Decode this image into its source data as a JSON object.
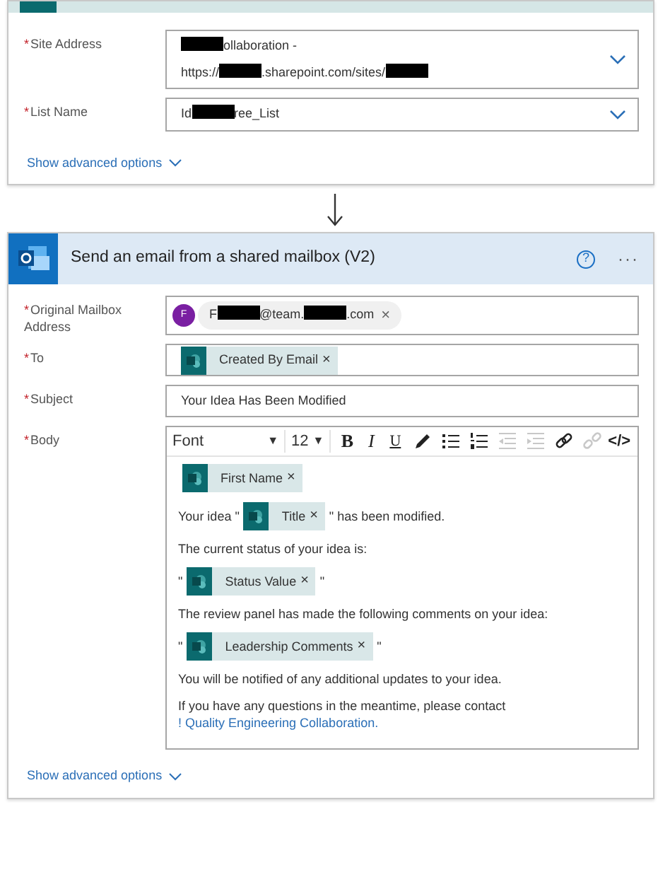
{
  "trigger_card": {
    "fields": [
      {
        "label": "Site Address",
        "required_mark": "*",
        "kind": "dropdown",
        "lines": [
          [
            {
              "kind": "redacted"
            },
            {
              "kind": "text",
              "text": "ollaboration -"
            }
          ],
          [
            {
              "kind": "text",
              "text": "https://"
            },
            {
              "kind": "redacted"
            },
            {
              "kind": "text",
              "text": ".sharepoint.com/sites/"
            },
            {
              "kind": "redacted"
            }
          ]
        ]
      },
      {
        "label": "List Name",
        "required_mark": "*",
        "kind": "dropdown",
        "lines": [
          [
            {
              "kind": "text",
              "text": "Id"
            },
            {
              "kind": "redacted"
            },
            {
              "kind": "text",
              "text": "ree_List"
            }
          ]
        ]
      }
    ],
    "advanced_link": "Show advanced options"
  },
  "action_card": {
    "title": "Send an email from a shared mailbox (V2)",
    "help": "?",
    "more": "···",
    "fields": [
      {
        "label": "Original Mailbox Address",
        "required_mark": "*",
        "kind": "person",
        "avatar": "F",
        "remove": "×",
        "value": [
          {
            "kind": "text",
            "text": "F"
          },
          {
            "kind": "redacted"
          },
          {
            "kind": "text",
            "text": "@team."
          },
          {
            "kind": "redacted"
          },
          {
            "kind": "text",
            "text": ".com"
          }
        ]
      },
      {
        "label": "To",
        "required_mark": "*",
        "kind": "tokens",
        "tokens": [
          {
            "label": "Created By Email",
            "remove": "×"
          }
        ]
      },
      {
        "label": "Subject",
        "required_mark": "*",
        "kind": "text",
        "value": "Your Idea Has Been Modified"
      },
      {
        "label": "Body",
        "required_mark": "*",
        "kind": "editor"
      }
    ],
    "toolbar": [
      {
        "kind": "font_select",
        "text": "Font",
        "caret": "▼"
      },
      {
        "kind": "size_select",
        "text": "12",
        "caret": "▼"
      },
      {
        "kind": "bold",
        "text": "B",
        "disabled": false
      },
      {
        "kind": "italic",
        "text": "I",
        "disabled": false
      },
      {
        "kind": "underline",
        "text": "U",
        "disabled": false
      },
      {
        "kind": "pen",
        "disabled": false
      },
      {
        "kind": "bullets",
        "disabled": false
      },
      {
        "kind": "numbers",
        "disabled": false
      },
      {
        "kind": "outdent",
        "disabled": true
      },
      {
        "kind": "indent",
        "disabled": true
      },
      {
        "kind": "link",
        "disabled": false
      },
      {
        "kind": "unlink",
        "disabled": true
      },
      {
        "kind": "code",
        "text": "</>",
        "disabled": false
      }
    ],
    "body": [
      [
        {
          "kind": "token",
          "text": "First Name",
          "remove": "×"
        }
      ],
      [
        {
          "kind": "text",
          "text": "Your idea \""
        },
        {
          "kind": "token",
          "text": "Title",
          "remove": "×"
        },
        {
          "kind": "text",
          "text": "\" has been modified."
        }
      ],
      [
        {
          "kind": "text",
          "text": "The current status of your idea is:"
        }
      ],
      [
        {
          "kind": "text",
          "text": "\""
        },
        {
          "kind": "token",
          "text": "Status Value",
          "remove": "×"
        },
        {
          "kind": "text",
          "text": "\""
        }
      ],
      [
        {
          "kind": "text",
          "text": "The review panel has made the following comments on your idea:"
        }
      ],
      [
        {
          "kind": "text",
          "text": "\""
        },
        {
          "kind": "token",
          "text": "Leadership Comments",
          "remove": "×"
        },
        {
          "kind": "text",
          "text": "\""
        }
      ],
      [
        {
          "kind": "text",
          "text": "You will be notified of any additional updates to your idea."
        }
      ],
      [
        {
          "kind": "text",
          "text": "If you have any questions in the meantime, please contact "
        },
        {
          "kind": "link",
          "text": "! Quality Engineering Collaboration."
        }
      ]
    ],
    "advanced_link": "Show advanced options"
  }
}
